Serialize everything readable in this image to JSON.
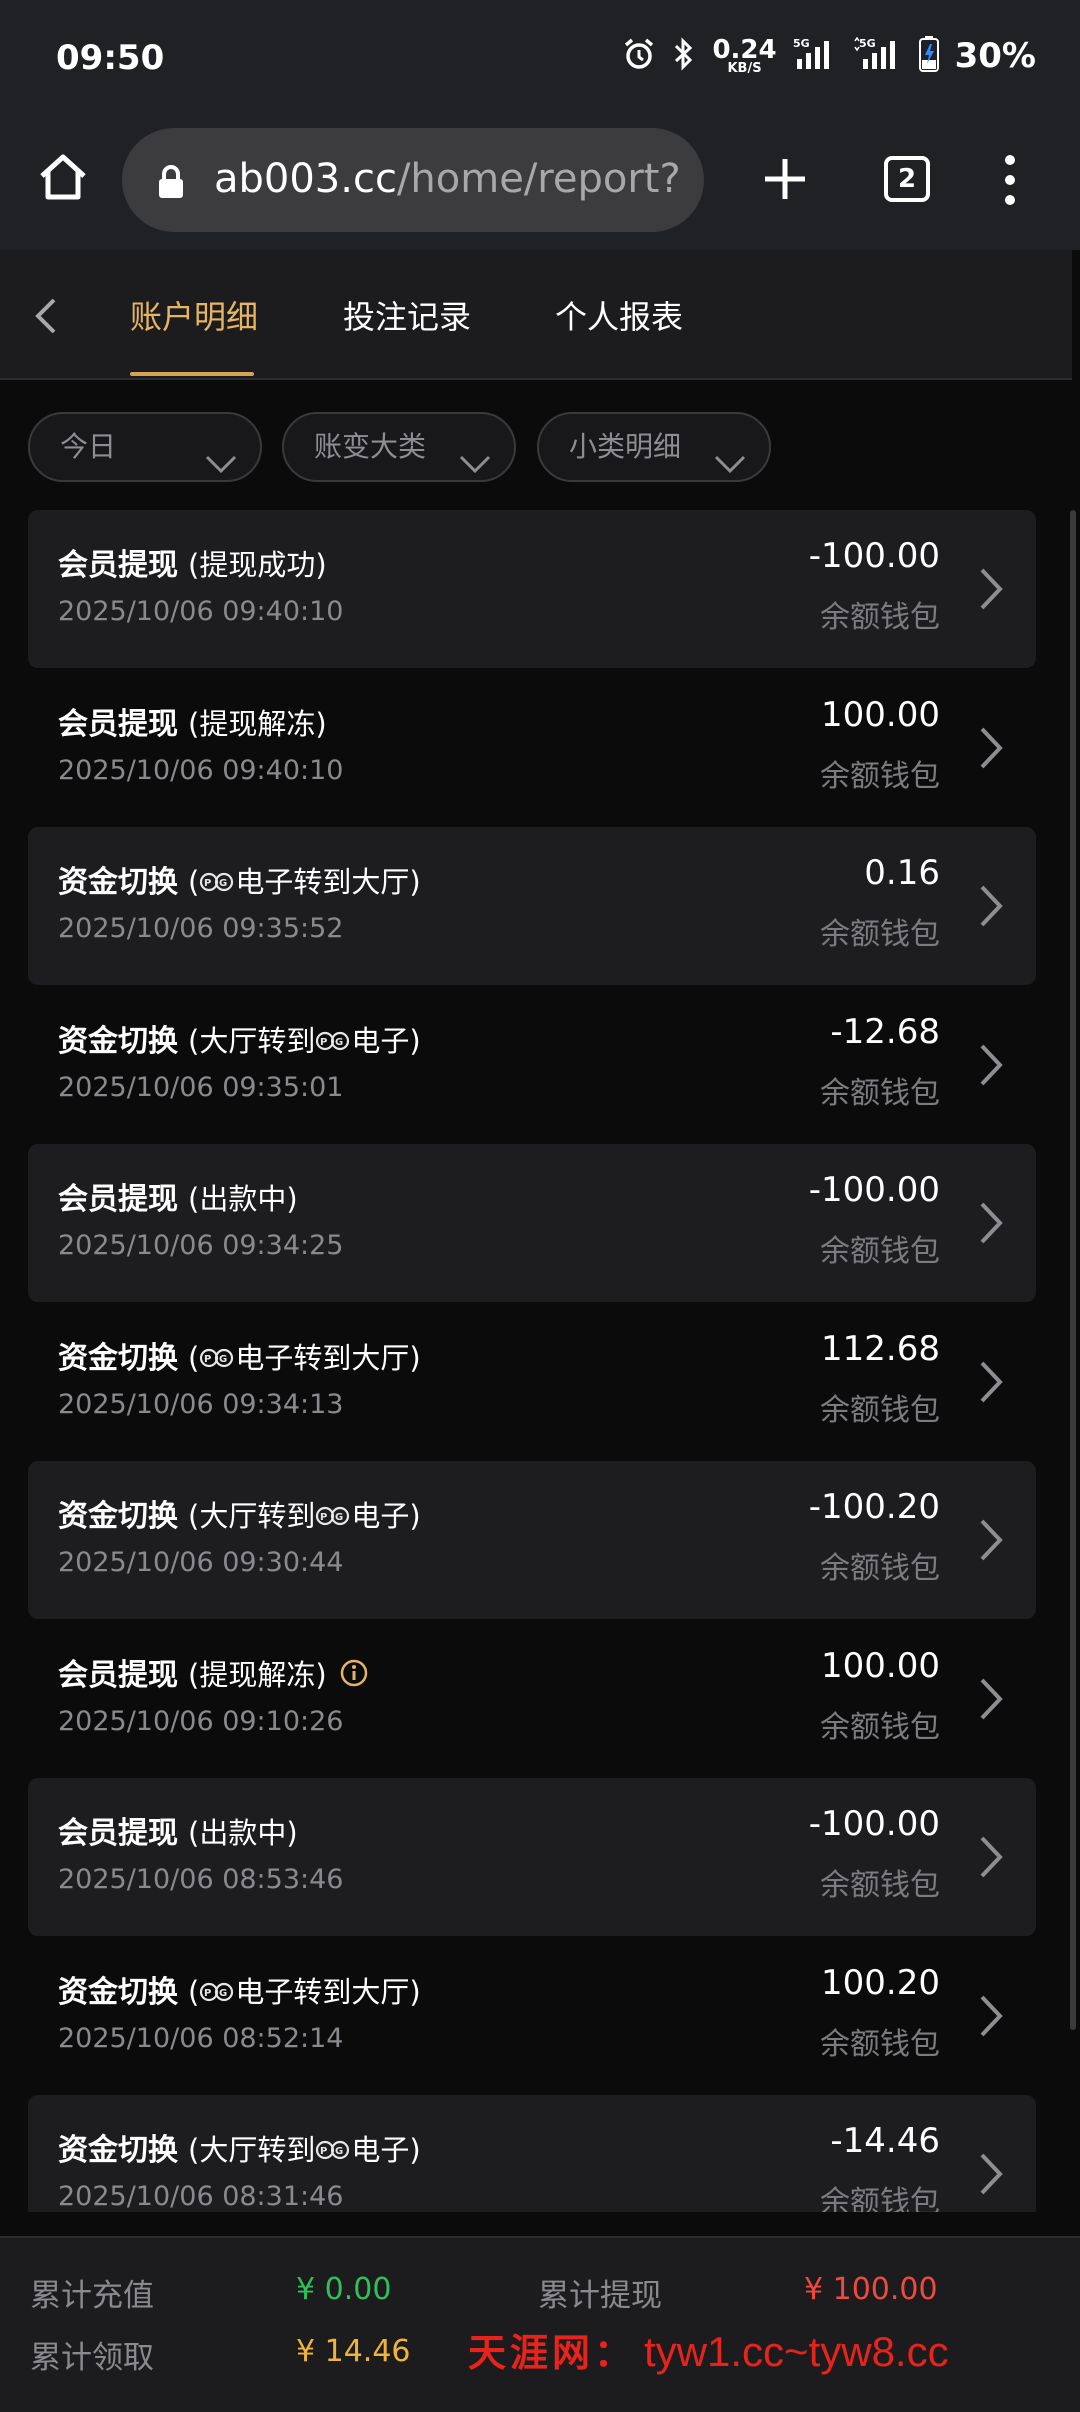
{
  "status_bar": {
    "time": "09:50",
    "net_speed_value": "0.24",
    "net_speed_unit": "KB/S",
    "signal1_label": "5G",
    "signal2_label": "5G",
    "battery": "30%"
  },
  "browser": {
    "url_domain": "ab003.cc",
    "url_path": "/home/report?re",
    "tab_count": "2"
  },
  "nav": {
    "tabs": [
      {
        "label": "账户明细",
        "active": true
      },
      {
        "label": "投注记录",
        "active": false
      },
      {
        "label": "个人报表",
        "active": false
      }
    ]
  },
  "filters": [
    {
      "label": "今日"
    },
    {
      "label": "账变大类"
    },
    {
      "label": "小类明细"
    }
  ],
  "records": [
    {
      "type": "会员提现",
      "detail_pre": "(提现成功)",
      "detail_post": "",
      "pg_logo": false,
      "info": false,
      "date": "2025/10/06 09:40:10",
      "amount": "-100.00",
      "wallet": "余额钱包"
    },
    {
      "type": "会员提现",
      "detail_pre": "(提现解冻)",
      "detail_post": "",
      "pg_logo": false,
      "info": false,
      "date": "2025/10/06 09:40:10",
      "amount": "100.00",
      "wallet": "余额钱包"
    },
    {
      "type": "资金切换",
      "detail_pre": "(",
      "detail_post": "电子转到大厅)",
      "pg_logo": true,
      "info": false,
      "date": "2025/10/06 09:35:52",
      "amount": "0.16",
      "wallet": "余额钱包"
    },
    {
      "type": "资金切换",
      "detail_pre": "(大厅转到",
      "detail_post": "电子)",
      "pg_logo": true,
      "info": false,
      "date": "2025/10/06 09:35:01",
      "amount": "-12.68",
      "wallet": "余额钱包"
    },
    {
      "type": "会员提现",
      "detail_pre": "(出款中)",
      "detail_post": "",
      "pg_logo": false,
      "info": false,
      "date": "2025/10/06 09:34:25",
      "amount": "-100.00",
      "wallet": "余额钱包"
    },
    {
      "type": "资金切换",
      "detail_pre": "(",
      "detail_post": "电子转到大厅)",
      "pg_logo": true,
      "info": false,
      "date": "2025/10/06 09:34:13",
      "amount": "112.68",
      "wallet": "余额钱包"
    },
    {
      "type": "资金切换",
      "detail_pre": "(大厅转到",
      "detail_post": "电子)",
      "pg_logo": true,
      "info": false,
      "date": "2025/10/06 09:30:44",
      "amount": "-100.20",
      "wallet": "余额钱包"
    },
    {
      "type": "会员提现",
      "detail_pre": "(提现解冻)",
      "detail_post": "",
      "pg_logo": false,
      "info": true,
      "date": "2025/10/06 09:10:26",
      "amount": "100.00",
      "wallet": "余额钱包"
    },
    {
      "type": "会员提现",
      "detail_pre": "(出款中)",
      "detail_post": "",
      "pg_logo": false,
      "info": false,
      "date": "2025/10/06 08:53:46",
      "amount": "-100.00",
      "wallet": "余额钱包"
    },
    {
      "type": "资金切换",
      "detail_pre": "(",
      "detail_post": "电子转到大厅)",
      "pg_logo": true,
      "info": false,
      "date": "2025/10/06 08:52:14",
      "amount": "100.20",
      "wallet": "余额钱包"
    },
    {
      "type": "资金切换",
      "detail_pre": "(大厅转到",
      "detail_post": "电子)",
      "pg_logo": true,
      "info": false,
      "date": "2025/10/06 08:31:46",
      "amount": "-14.46",
      "wallet": "余额钱包"
    }
  ],
  "summary": {
    "recharge_label": "累计充值",
    "recharge_value": "¥ 0.00",
    "withdraw_label": "累计提现",
    "withdraw_value": "¥ 100.00",
    "claim_label": "累计领取",
    "claim_value": "¥ 14.46"
  },
  "watermark": {
    "cn": "天涯网：",
    "url": "tyw1.cc~tyw8.cc"
  },
  "colors": {
    "active_tab": "#e6b564",
    "positive_total": "#2fbf5b",
    "withdraw_total": "#f04a3e",
    "claim_total": "#f0b43a",
    "watermark": "#e8231c"
  }
}
